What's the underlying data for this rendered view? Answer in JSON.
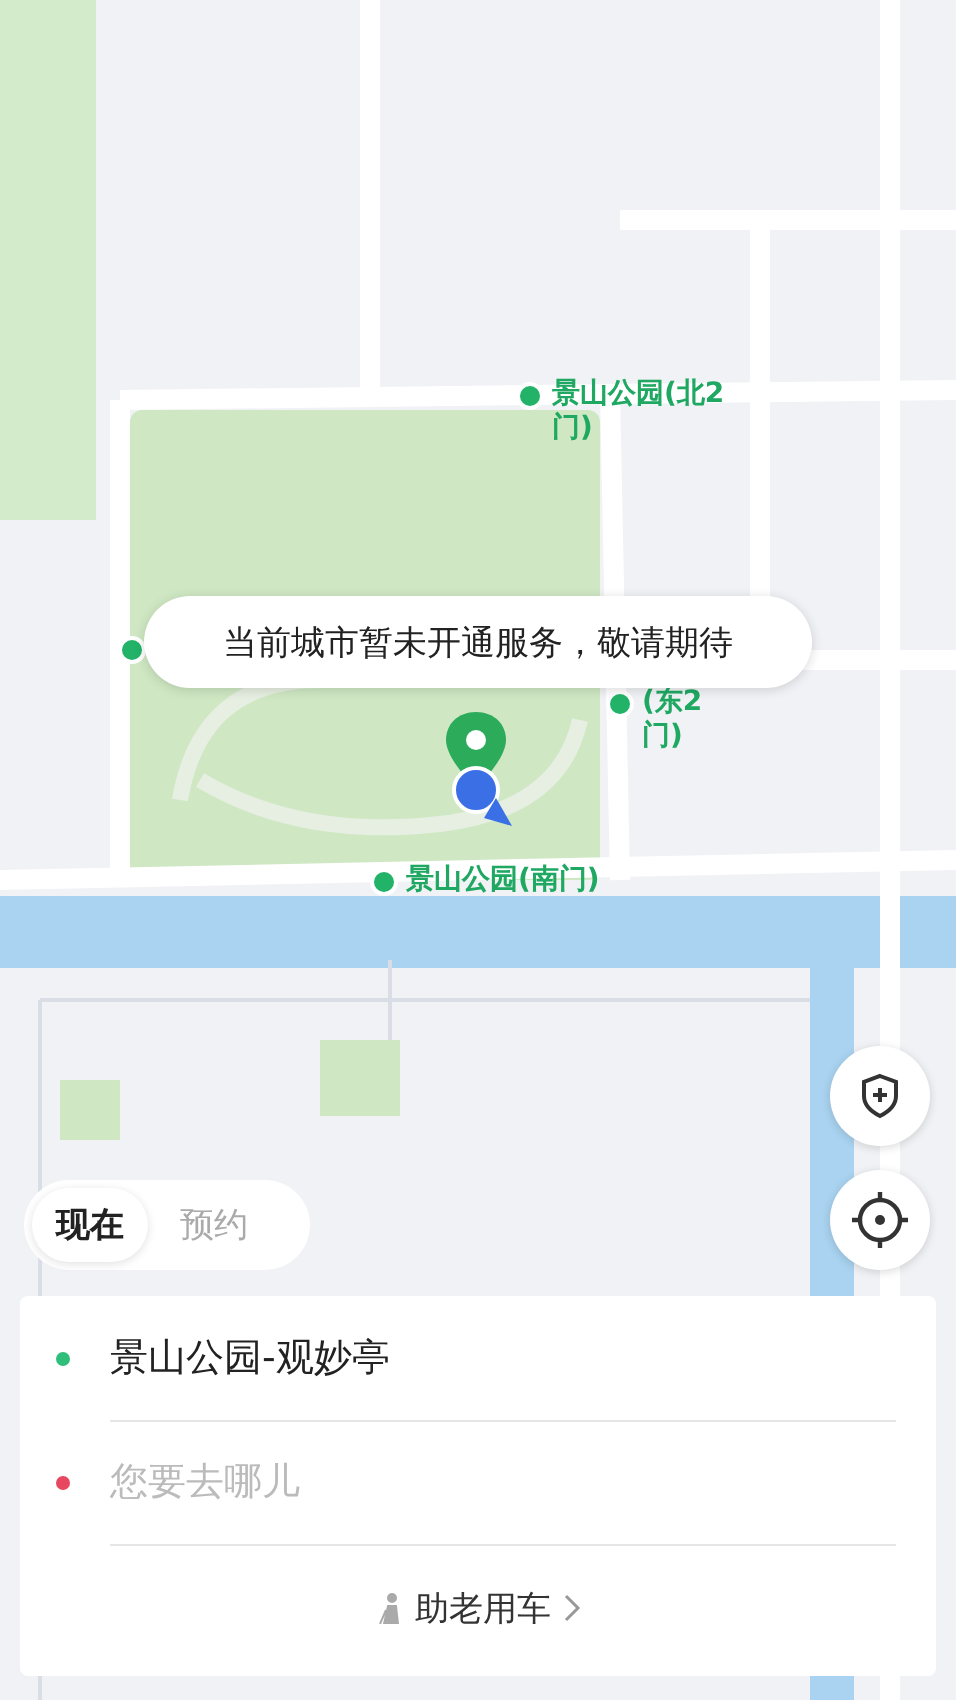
{
  "notice": {
    "text": "当前城市暂未开通服务，敬请期待"
  },
  "pickup_points": [
    {
      "kind": "labeled",
      "label": "景山公园(北2\n门)"
    },
    {
      "kind": "labeled",
      "label": "(东2\n门)"
    },
    {
      "kind": "labeled",
      "label": "景山公园(南门)"
    },
    {
      "kind": "dot"
    }
  ],
  "mode_tabs": [
    {
      "label": "现在",
      "selected": true
    },
    {
      "label": "预约",
      "selected": false
    }
  ],
  "trip": {
    "origin": "景山公园-观妙亭",
    "destination_placeholder": "您要去哪儿"
  },
  "elder_service": {
    "label": "助老用车"
  }
}
